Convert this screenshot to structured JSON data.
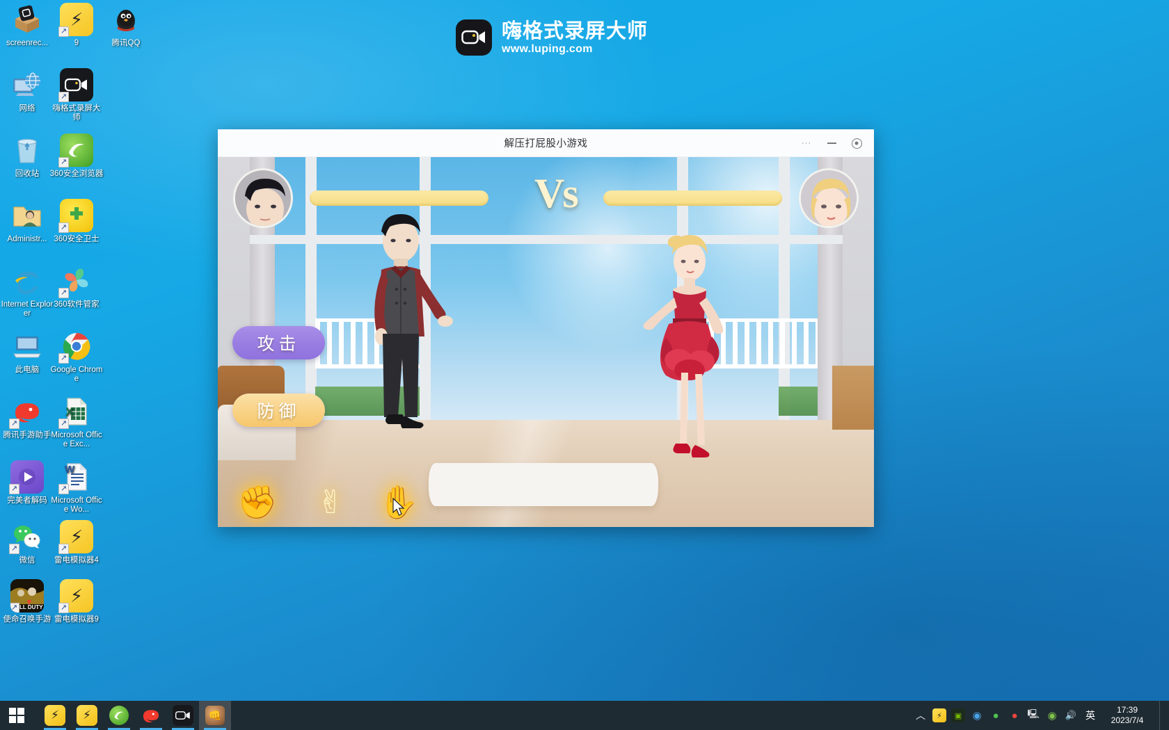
{
  "desktop": {
    "icons": [
      {
        "label": "screenrec...",
        "icon": "box-package-icon",
        "col": 0,
        "row": 0,
        "shortcut": false
      },
      {
        "label": "9",
        "icon": "ldplayer-icon",
        "col": 1,
        "row": 0,
        "shortcut": true
      },
      {
        "label": "腾讯QQ",
        "icon": "qq-penguin-icon",
        "col": 2,
        "row": 0,
        "shortcut": false
      },
      {
        "label": "网络",
        "icon": "network-globe-icon",
        "col": 0,
        "row": 1,
        "shortcut": false
      },
      {
        "label": "嗨格式录屏大师",
        "icon": "screen-recorder-icon",
        "col": 1,
        "row": 1,
        "shortcut": true
      },
      {
        "label": "回收站",
        "icon": "recycle-bin-icon",
        "col": 0,
        "row": 2,
        "shortcut": false
      },
      {
        "label": "360安全浏览器",
        "icon": "360-browser-icon",
        "col": 1,
        "row": 2,
        "shortcut": true
      },
      {
        "label": "Administr...",
        "icon": "user-folder-icon",
        "col": 0,
        "row": 3,
        "shortcut": false
      },
      {
        "label": "360安全卫士",
        "icon": "360-guard-icon",
        "col": 1,
        "row": 3,
        "shortcut": true
      },
      {
        "label": "Internet Explorer",
        "icon": "internet-explorer-icon",
        "col": 0,
        "row": 4,
        "shortcut": false
      },
      {
        "label": "360软件管家",
        "icon": "360-software-manager-icon",
        "col": 1,
        "row": 4,
        "shortcut": true
      },
      {
        "label": "此电脑",
        "icon": "this-pc-icon",
        "col": 0,
        "row": 5,
        "shortcut": false
      },
      {
        "label": "Google Chrome",
        "icon": "chrome-icon",
        "col": 1,
        "row": 5,
        "shortcut": true
      },
      {
        "label": "腾讯手游助手",
        "icon": "tencent-gamebuddy-icon",
        "col": 0,
        "row": 6,
        "shortcut": true
      },
      {
        "label": "Microsoft Office Exc...",
        "icon": "excel-icon",
        "col": 1,
        "row": 6,
        "shortcut": true
      },
      {
        "label": "完美者解码",
        "icon": "wanmeizhe-decoder-icon",
        "col": 0,
        "row": 7,
        "shortcut": true
      },
      {
        "label": "Microsoft Office Wo...",
        "icon": "word-icon",
        "col": 1,
        "row": 7,
        "shortcut": true
      },
      {
        "label": "微信",
        "icon": "wechat-icon",
        "col": 0,
        "row": 8,
        "shortcut": true
      },
      {
        "label": "雷电模拟器4",
        "icon": "ldplayer-icon",
        "col": 1,
        "row": 8,
        "shortcut": true
      },
      {
        "label": "使命召唤手游",
        "icon": "call-of-duty-icon",
        "col": 0,
        "row": 9,
        "shortcut": true
      },
      {
        "label": "雷电模拟器9",
        "icon": "ldplayer-icon",
        "col": 1,
        "row": 9,
        "shortcut": true
      }
    ]
  },
  "watermark": {
    "title": "嗨格式录屏大师",
    "url": "www.luping.com",
    "logo_icon": "video-camera-icon"
  },
  "game_window": {
    "title": "解压打屁股小游戏",
    "controls": {
      "more": "···",
      "minimize": "—",
      "close": "◉"
    },
    "vs_label": "Vs",
    "player_left": {
      "avatar": "male-avatar",
      "hp_color": "#f6dd85"
    },
    "player_right": {
      "avatar": "female-avatar",
      "hp_color": "#f6dd85"
    },
    "actions": [
      {
        "label": "攻击",
        "name": "attack-button",
        "color": "#9a7ee2"
      },
      {
        "label": "防御",
        "name": "defend-button",
        "color": "#f9d285"
      }
    ],
    "gestures": [
      {
        "name": "rock-gesture-button",
        "glyph": "✊"
      },
      {
        "name": "scissors-gesture-button",
        "glyph": "✌"
      },
      {
        "name": "paper-gesture-button",
        "glyph": "✋"
      }
    ]
  },
  "taskbar": {
    "start_icon": "windows-start-icon",
    "pinned": [
      {
        "name": "taskbar-ldplayer",
        "icon": "ldplayer-icon"
      },
      {
        "name": "taskbar-ldplayer-9",
        "icon": "ldplayer-icon"
      },
      {
        "name": "taskbar-360-browser",
        "icon": "360-browser-icon"
      },
      {
        "name": "taskbar-tencent-gamebuddy",
        "icon": "tencent-gamebuddy-icon"
      },
      {
        "name": "taskbar-screen-recorder",
        "icon": "screen-recorder-icon"
      },
      {
        "name": "taskbar-game-window",
        "icon": "game-icon"
      }
    ],
    "tray": [
      {
        "name": "tray-show-hidden",
        "glyph": "︿"
      },
      {
        "name": "tray-ldplayer",
        "glyph": "⚡"
      },
      {
        "name": "tray-nvidia",
        "glyph": "▣"
      },
      {
        "name": "tray-360-speed",
        "glyph": "◉"
      },
      {
        "name": "tray-360-browser",
        "glyph": "●"
      },
      {
        "name": "tray-tencent",
        "glyph": "●"
      },
      {
        "name": "tray-display",
        "glyph": "🖥"
      },
      {
        "name": "tray-game-center",
        "glyph": "◉"
      },
      {
        "name": "tray-volume",
        "glyph": "🔊"
      }
    ],
    "ime": "英",
    "clock": {
      "time": "17:39",
      "date": "2023/7/4"
    }
  }
}
